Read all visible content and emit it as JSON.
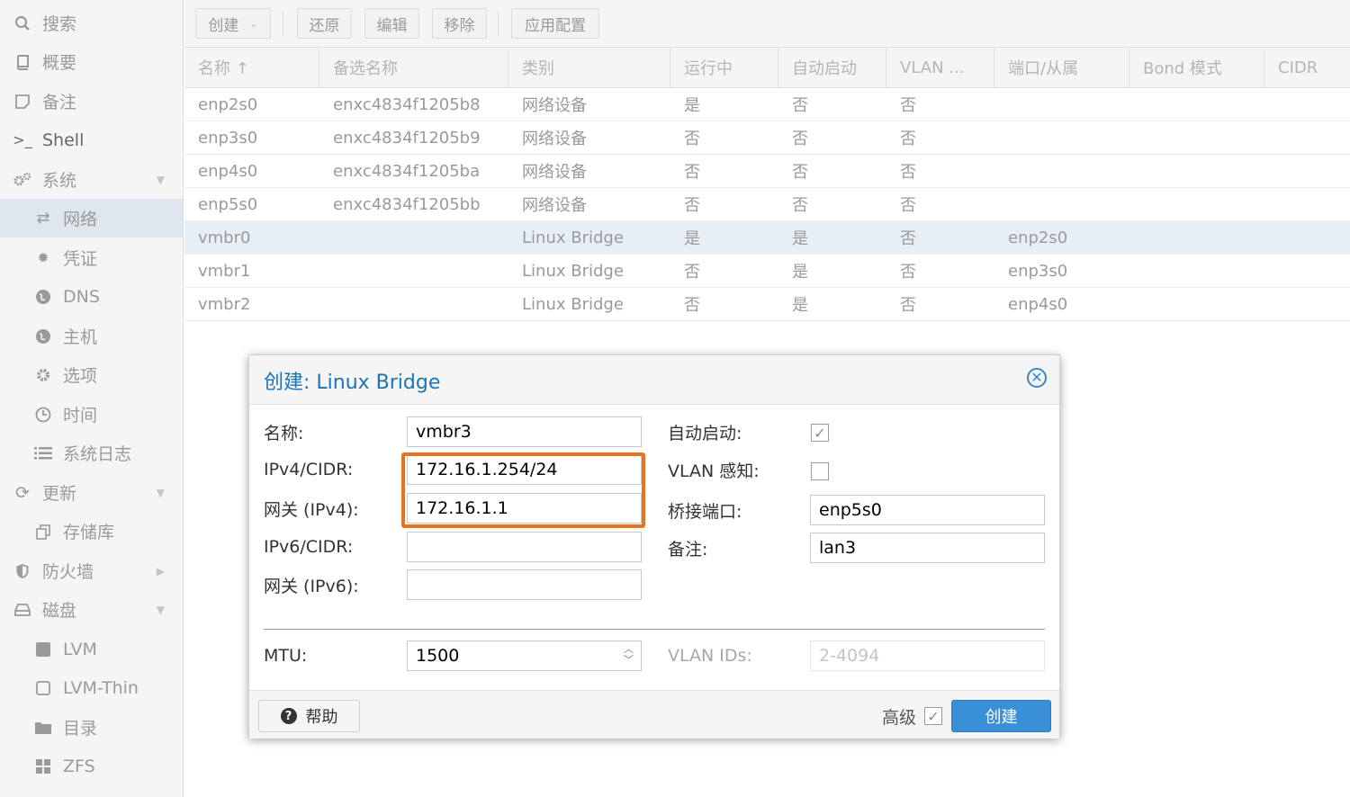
{
  "sidebar": {
    "search": "搜索",
    "summary": "概要",
    "notes": "备注",
    "shell": "Shell",
    "system": "系统",
    "network": "网络",
    "certificates": "凭证",
    "dns": "DNS",
    "hosts": "主机",
    "options": "选项",
    "time": "时间",
    "syslog": "系统日志",
    "updates": "更新",
    "repositories": "存储库",
    "firewall": "防火墙",
    "disks": "磁盘",
    "lvm": "LVM",
    "lvm_thin": "LVM-Thin",
    "directory": "目录",
    "zfs": "ZFS"
  },
  "toolbar": {
    "create": "创建",
    "revert": "还原",
    "edit": "编辑",
    "remove": "移除",
    "apply": "应用配置"
  },
  "grid": {
    "columns": [
      "名称 ↑",
      "备选名称",
      "类别",
      "运行中",
      "自动启动",
      "VLAN ...",
      "端口/从属",
      "Bond 模式",
      "CIDR"
    ],
    "rows": [
      [
        "enp2s0",
        "enxc4834f1205b8",
        "网络设备",
        "是",
        "否",
        "否",
        ""
      ],
      [
        "enp3s0",
        "enxc4834f1205b9",
        "网络设备",
        "否",
        "否",
        "否",
        ""
      ],
      [
        "enp4s0",
        "enxc4834f1205ba",
        "网络设备",
        "否",
        "否",
        "否",
        ""
      ],
      [
        "enp5s0",
        "enxc4834f1205bb",
        "网络设备",
        "否",
        "否",
        "否",
        ""
      ],
      [
        "vmbr0",
        "",
        "Linux Bridge",
        "是",
        "是",
        "否",
        "enp2s0"
      ],
      [
        "vmbr1",
        "",
        "Linux Bridge",
        "否",
        "是",
        "否",
        "enp3s0"
      ],
      [
        "vmbr2",
        "",
        "Linux Bridge",
        "否",
        "是",
        "否",
        "enp4s0"
      ]
    ]
  },
  "dialog": {
    "title": "创建: Linux Bridge",
    "labels": {
      "name": "名称:",
      "ipv4": "IPv4/CIDR:",
      "gw4": "网关 (IPv4):",
      "ipv6": "IPv6/CIDR:",
      "gw6": "网关 (IPv6):",
      "autostart": "自动启动:",
      "vlan_aware": "VLAN 感知:",
      "bridge_ports": "桥接端口:",
      "comment": "备注:",
      "mtu": "MTU:",
      "vlan_ids": "VLAN IDs:"
    },
    "values": {
      "name": "vmbr3",
      "ipv4": "172.16.1.254/24",
      "gw4": "172.16.1.1",
      "ipv6": "",
      "gw6": "",
      "bridge_ports": "enp5s0",
      "comment": "lan3",
      "mtu": "1500",
      "vlan_ids": "2-4094"
    },
    "autostart_checked": true,
    "vlan_aware_checked": false,
    "advanced_checked": true,
    "help": "帮助",
    "advanced": "高级",
    "create": "创建"
  },
  "colors": {
    "accent": "#3a8fd9",
    "highlight": "#e8731d",
    "title": "#1e73b3"
  }
}
